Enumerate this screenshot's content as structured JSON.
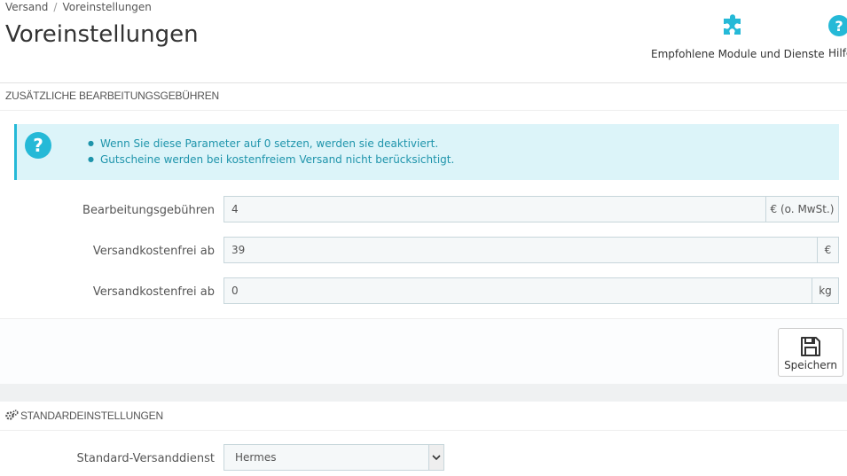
{
  "breadcrumb": {
    "items": [
      "Versand",
      "Voreinstellungen"
    ],
    "separator": "/"
  },
  "page_title": "Voreinstellungen",
  "toolbar": {
    "modules_label": "Empfohlene Module und Dienste",
    "modules_icon": "puzzle-icon",
    "help_label": "Hilfe",
    "help_icon": "question-circle-icon"
  },
  "handling_panel": {
    "heading": "Zusätzliche Bearbeitungsgebühren",
    "alert_icon": "question-circle-icon",
    "alert_lines": [
      "Wenn Sie diese Parameter auf 0 setzen, werden sie deaktiviert.",
      "Gutscheine werden bei kostenfreiem Versand nicht berücksichtigt."
    ],
    "fields": [
      {
        "label": "Bearbeitungsgebühren",
        "value": "4",
        "suffix": "€ (o. MwSt.)"
      },
      {
        "label": "Versandkostenfrei ab",
        "value": "39",
        "suffix": "€"
      },
      {
        "label": "Versandkostenfrei ab",
        "value": "0",
        "suffix": "kg"
      }
    ],
    "save_label": "Speichern",
    "save_icon": "floppy-disk-icon"
  },
  "default_panel": {
    "heading": "Standardeinstellungen",
    "heading_icon": "cogs-icon",
    "carrier_label": "Standard-Versanddienst",
    "carrier_value": "Hermes"
  },
  "colors": {
    "accent": "#25b9d7",
    "alert_bg": "#dcf4f9",
    "alert_text": "#1e94ab",
    "input_bg": "#f5f8f9",
    "input_border": "#c7d6db"
  }
}
